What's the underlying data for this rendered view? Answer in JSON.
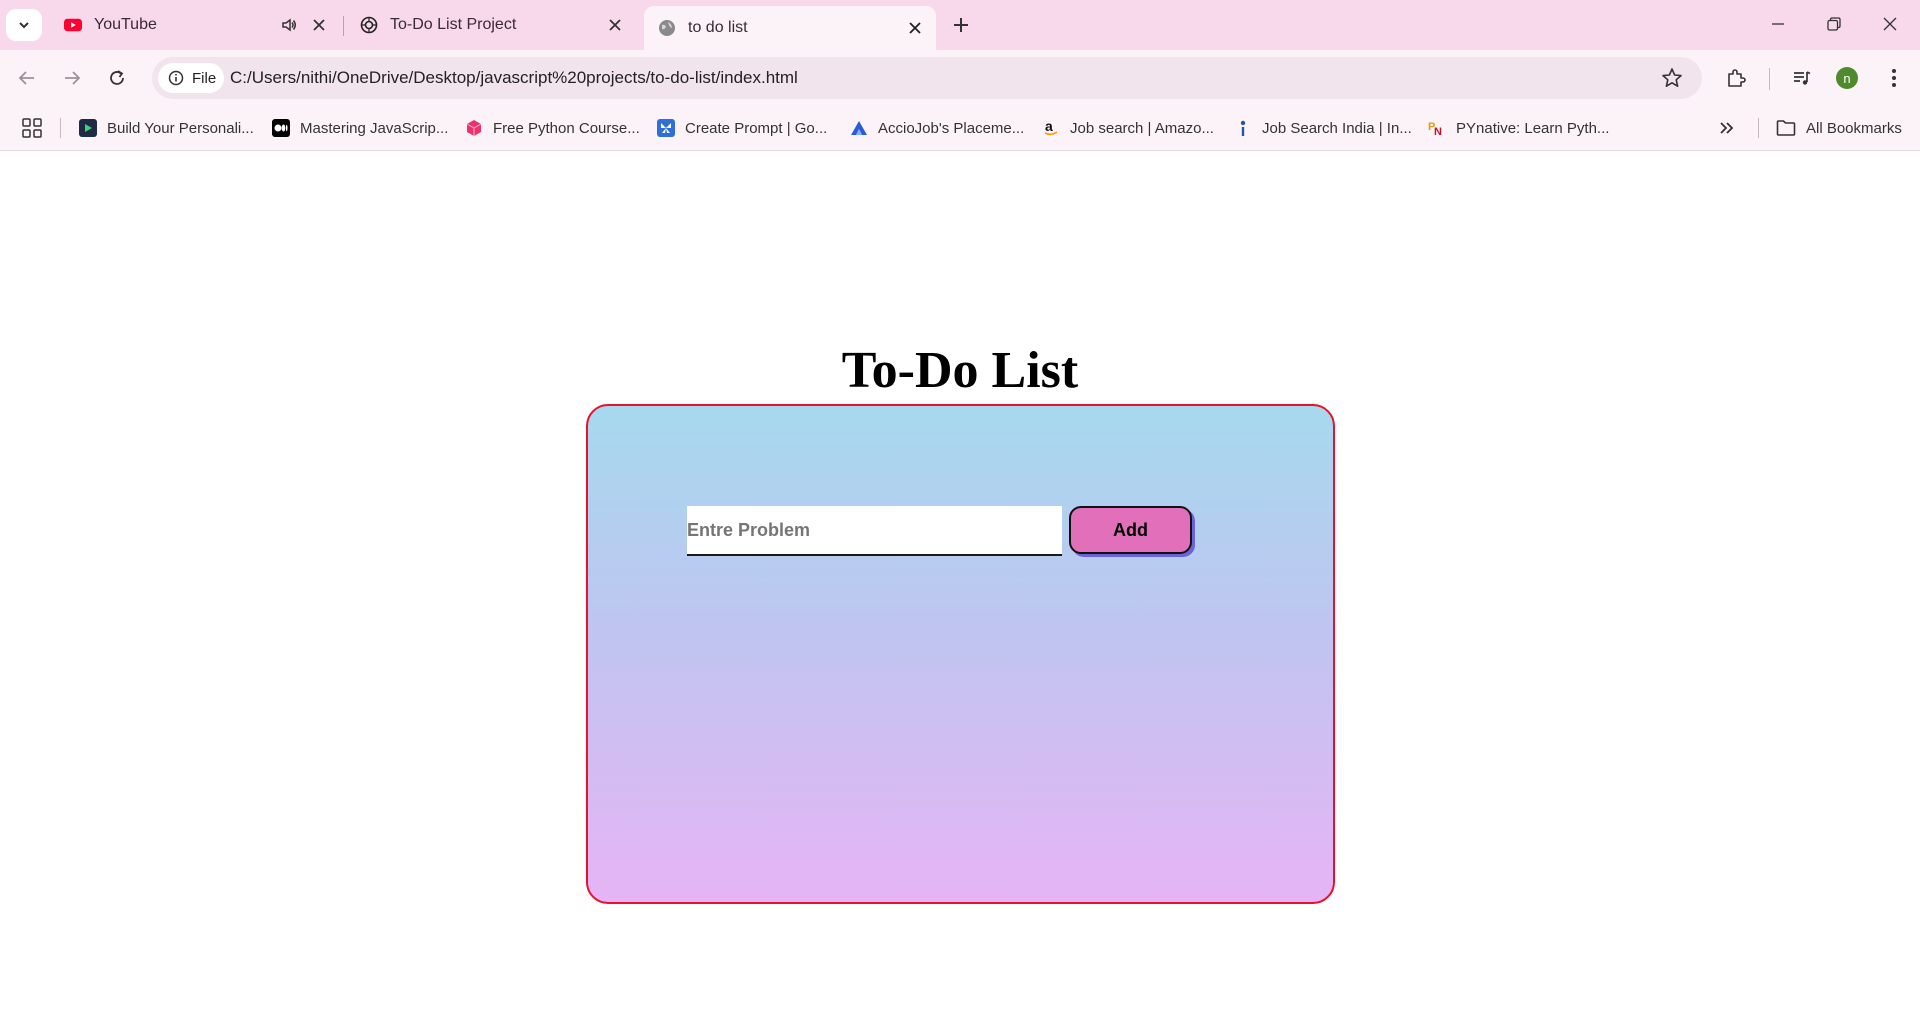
{
  "browser": {
    "tabs": [
      {
        "title": "YouTube",
        "favicon": "youtube-icon",
        "audio": true,
        "active": false
      },
      {
        "title": "To-Do List Project",
        "favicon": "openai-icon",
        "audio": false,
        "active": false
      },
      {
        "title": "to do list",
        "favicon": "globe-icon",
        "audio": false,
        "active": true
      }
    ],
    "address": {
      "chip_label": "File",
      "url": "C:/Users/nithi/OneDrive/Desktop/javascript%20projects/to-do-list/index.html"
    },
    "profile_initial": "n",
    "bookmarks": [
      {
        "label": "Build Your Personali...",
        "icon": "play-icon",
        "color": "#1f2a44"
      },
      {
        "label": "Mastering JavaScrip...",
        "icon": "medium-icon",
        "color": "#000000"
      },
      {
        "label": "Free Python Course...",
        "icon": "cube-icon",
        "color": "#e8336d"
      },
      {
        "label": "Create Prompt | Go...",
        "icon": "butterfly-icon",
        "color": "#2f6fd6"
      },
      {
        "label": "AccioJob's Placeme...",
        "icon": "accio-icon",
        "color": "#2b5cd8"
      },
      {
        "label": "Job search | Amazo...",
        "icon": "amazon-icon",
        "color": "#ffffff"
      },
      {
        "label": "Job Search India | In...",
        "icon": "indeed-icon",
        "color": "#ffffff"
      },
      {
        "label": "PYnative: Learn Pyth...",
        "icon": "pynative-icon",
        "color": "#ffffff"
      }
    ],
    "all_bookmarks_label": "All Bookmarks"
  },
  "page": {
    "heading": "To-Do List",
    "input_placeholder": "Entre Problem",
    "input_value": "",
    "add_button_label": "Add",
    "colors": {
      "card_border": "#e8112d",
      "gradient_top": "#a6d9ee",
      "gradient_bottom": "#e6b4f5",
      "button_bg": "#e26fb9",
      "button_shadow": "#6b63d8"
    }
  }
}
